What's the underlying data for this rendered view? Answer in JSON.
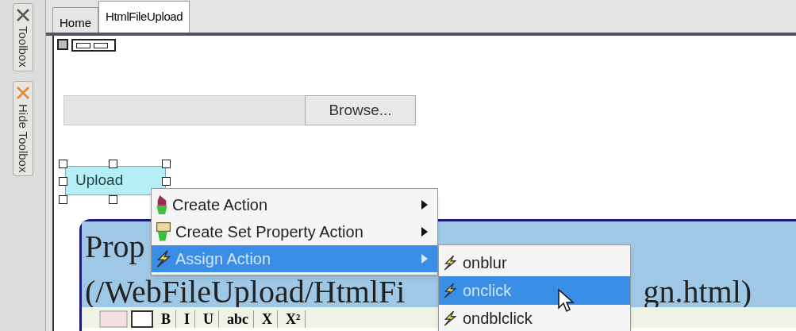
{
  "sidebar": {
    "tabs": [
      {
        "label": "Toolbox"
      },
      {
        "label": "Hide Toolbox"
      }
    ]
  },
  "tabs": [
    {
      "label": "Home",
      "selected": false
    },
    {
      "label": "HtmlFileUpload",
      "selected": true
    }
  ],
  "form": {
    "browse_button": "Browse...",
    "upload_button": {
      "label": "Upload",
      "selected": true
    }
  },
  "properties_panel": {
    "title_parts": [
      "Prop",
      "(/WebFileUpload/HtmlFi",
      "gn.html)"
    ],
    "toolbar": [
      "B",
      "I",
      "U",
      "abc",
      "X",
      "X²"
    ]
  },
  "context_menu": {
    "items": [
      {
        "label": "Create Action",
        "selected": false,
        "kind": "action"
      },
      {
        "label": "Create Set Property Action",
        "selected": false,
        "kind": "property"
      },
      {
        "label": "Assign Action",
        "selected": true,
        "kind": "assign"
      }
    ]
  },
  "submenu": {
    "items": [
      {
        "label": "onblur",
        "selected": false
      },
      {
        "label": "onclick",
        "selected": true
      },
      {
        "label": "ondblclick",
        "selected": false
      }
    ]
  }
}
